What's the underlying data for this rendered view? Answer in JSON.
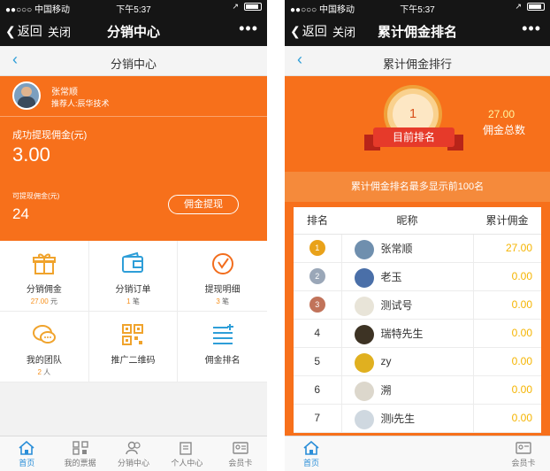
{
  "left": {
    "status": {
      "carrier": "●●○○○ 中国移动",
      "time": "下午5:37",
      "arrow": "↗"
    },
    "nav": {
      "back": "返回",
      "close": "关闭",
      "title": "分销中心",
      "more": "•••"
    },
    "subhead": {
      "title": "分销中心"
    },
    "profile": {
      "name": "张常顺",
      "referrer": "推荐人:辰华技术"
    },
    "earnings": {
      "success_label": "成功提现佣金(元)",
      "success_value": "3.00",
      "available_label": "可提现佣金(元)",
      "available_value": "24",
      "withdraw_button": "佣金提现"
    },
    "grid": [
      {
        "label": "分销佣金",
        "sub_num": "27.00",
        "sub_unit": " 元",
        "icon": "gift-icon"
      },
      {
        "label": "分销订单",
        "sub_num": "1",
        "sub_unit": " 笔",
        "icon": "wallet-icon"
      },
      {
        "label": "提现明细",
        "sub_num": "3",
        "sub_unit": " 笔",
        "icon": "clock-icon"
      },
      {
        "label": "我的团队",
        "sub_num": "2",
        "sub_unit": " 人",
        "icon": "chat-icon"
      },
      {
        "label": "推广二维码",
        "sub_num": "",
        "sub_unit": "",
        "icon": "qrcode-icon"
      },
      {
        "label": "佣金排名",
        "sub_num": "",
        "sub_unit": "",
        "icon": "list-icon"
      }
    ],
    "tabs": [
      {
        "label": "首页",
        "icon": "home-icon",
        "active": true
      },
      {
        "label": "我的票据",
        "icon": "barcode-icon",
        "active": false
      },
      {
        "label": "分销中心",
        "icon": "people-icon",
        "active": false
      },
      {
        "label": "个人中心",
        "icon": "edit-icon",
        "active": false
      },
      {
        "label": "会员卡",
        "icon": "card-icon",
        "active": false
      }
    ]
  },
  "right": {
    "status": {
      "carrier": "●●○○○ 中国移动",
      "time": "下午5:37",
      "arrow": "↗"
    },
    "nav": {
      "back": "返回",
      "close": "关闭",
      "title": "累计佣金排名",
      "more": "•••"
    },
    "subhead": {
      "title": "累计佣金排行"
    },
    "banner": {
      "rank": "1",
      "rank_label": "目前排名",
      "total_value": "27.00",
      "total_label": "佣金总数"
    },
    "notice": "累计佣金排名最多显示前100名",
    "table": {
      "headers": [
        "排名",
        "昵称",
        "累计佣金"
      ],
      "rows": [
        {
          "rank": "1",
          "name": "张常顺",
          "amount": "27.00",
          "medal": "#e9a21a"
        },
        {
          "rank": "2",
          "name": "老玉",
          "amount": "0.00",
          "medal": "#9aa7b8"
        },
        {
          "rank": "3",
          "name": "测试号",
          "amount": "0.00",
          "medal": "#c1735a"
        },
        {
          "rank": "4",
          "name": "瑞特先生",
          "amount": "0.00",
          "medal": ""
        },
        {
          "rank": "5",
          "name": "zy",
          "amount": "0.00",
          "medal": ""
        },
        {
          "rank": "6",
          "name": "溯",
          "amount": "0.00",
          "medal": ""
        },
        {
          "rank": "7",
          "name": "测i先生",
          "amount": "0.00",
          "medal": ""
        }
      ]
    },
    "tabs": [
      {
        "label": "首页",
        "icon": "home-icon",
        "active": true
      },
      {
        "label": "会员卡",
        "icon": "card-icon",
        "active": false
      }
    ]
  },
  "colors": {
    "orange": "#f7701b",
    "dark_nav": "#151515",
    "link_blue": "#2e9ed8",
    "gold": "#f5b400"
  }
}
